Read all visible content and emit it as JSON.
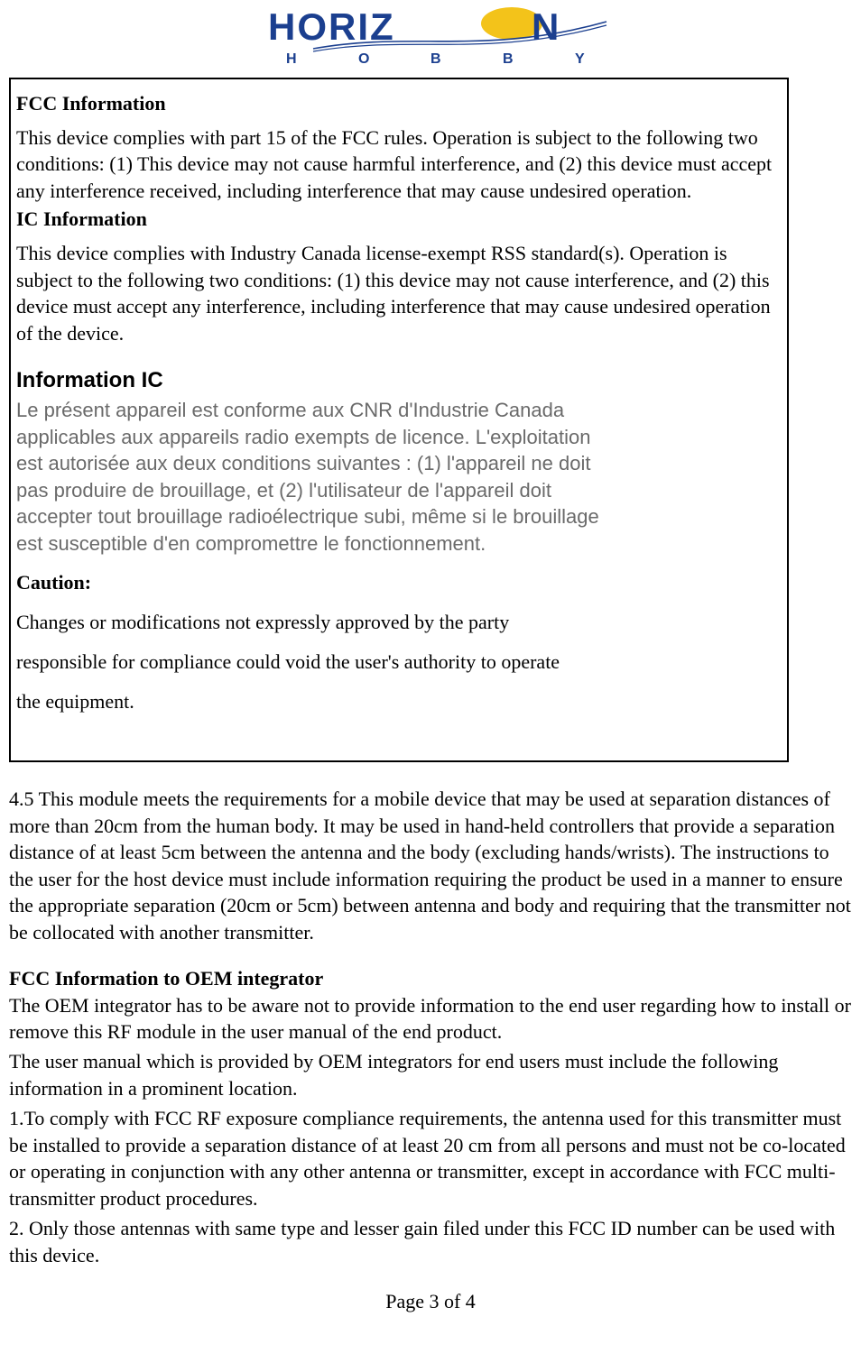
{
  "logo": {
    "brand_main": "HORIZON",
    "brand_sub_letters": [
      "H",
      "O",
      "B",
      "B",
      "Y"
    ]
  },
  "box": {
    "fcc_heading": "FCC Information",
    "fcc_body": "This device complies with part 15 of the FCC rules. Operation is subject to the following two conditions: (1) This device may not cause harmful interference, and (2) this device must accept any interference received, including interference that may cause undesired operation.",
    "ic_heading": "IC Information",
    "ic_body": "This device complies with Industry Canada license-exempt RSS standard(s).  Operation is subject to the following two conditions: (1) this device may not cause interference, and (2) this device must accept any interference, including interference that may cause undesired operation of the device.",
    "fr_heading": "Information IC",
    "fr_body": "Le présent appareil est conforme aux CNR d'Industrie Canada applicables aux appareils radio exempts de licence. L'exploitation est autorisée aux deux conditions suivantes : (1) l'appareil ne doit pas produire de brouillage, et (2) l'utilisateur de l'appareil doit accepter tout brouillage radioélectrique subi, même si le brouillage est susceptible d'en compromettre le fonctionnement.",
    "caution_heading": "Caution:",
    "caution_line1": "Changes or modifications not expressly approved by the party",
    "caution_line2": "responsible for compliance could void the user's authority to operate",
    "caution_line3": "the equipment."
  },
  "below": {
    "sep_body": "4.5 This module meets the requirements for a mobile device that may be used at separation distances of more than 20cm from the human body. It may be used in hand-held controllers that provide a separation distance of at least 5cm between the antenna and the body (excluding hands/wrists). The instructions to the user for the host device must include information requiring the product be used in a manner to ensure the appropriate separation (20cm or 5cm) between antenna and body and requiring that the transmitter not be collocated with another transmitter.",
    "oem_heading": "FCC Information to OEM integrator",
    "oem_p1": "The OEM integrator has to be aware not to provide information to the end user regarding how to install or remove this RF module in the user manual of the end product.",
    "oem_p2": "The user manual which is provided by OEM integrators for end users must include the following information in a prominent location.",
    "oem_p3": "1.To comply with FCC RF exposure compliance requirements, the antenna used for this transmitter must be installed to provide a separation distance of at least 20 cm from all persons and must not be co-located or operating in conjunction with any other antenna or transmitter, except in accordance with FCC multi-transmitter product procedures.",
    "oem_p4": "2. Only those antennas with same type and lesser gain filed under this FCC ID number can be used with this device."
  },
  "footer": {
    "page_label": "Page 3 of 4"
  }
}
